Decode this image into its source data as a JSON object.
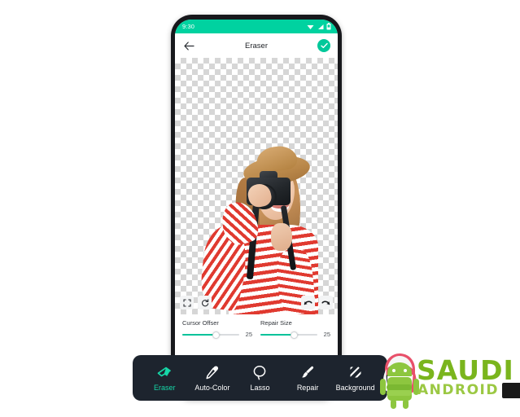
{
  "device": {
    "status_bar": {
      "time": "9:30",
      "icons": [
        "wifi-icon",
        "signal-icon",
        "battery-icon"
      ],
      "background_color": "#00d2a0"
    }
  },
  "app_bar": {
    "back_icon": "back-arrow-icon",
    "title": "Eraser",
    "confirm_icon": "check-icon",
    "confirm_color": "#00c89a"
  },
  "canvas": {
    "transparency_pattern": "checkerboard",
    "subject_description": "woman in red and white striped shirt and tan sun hat holding a black DSLR camera",
    "left_buttons": [
      {
        "name": "fit-to-screen-button",
        "icon": "fullscreen-icon"
      },
      {
        "name": "reset-button",
        "icon": "refresh-icon"
      }
    ],
    "right_buttons": [
      {
        "name": "undo-button",
        "icon": "undo-icon"
      },
      {
        "name": "redo-button",
        "icon": "redo-icon"
      }
    ]
  },
  "sliders": [
    {
      "label": "Cursor Offser",
      "value": "25",
      "percent": 58
    },
    {
      "label": "Repair Size",
      "value": "25",
      "percent": 58
    }
  ],
  "toolbar": {
    "background_color": "#1d242e",
    "active_color": "#16d6a7",
    "items": [
      {
        "label": "Eraser",
        "icon": "eraser-icon",
        "active": true
      },
      {
        "label": "Auto-Color",
        "icon": "eyedropper-icon",
        "active": false
      },
      {
        "label": "Lasso",
        "icon": "lasso-icon",
        "active": false
      },
      {
        "label": "Repair",
        "icon": "paintbrush-icon",
        "active": false
      },
      {
        "label": "Background",
        "icon": "diagonal-stripes-icon",
        "active": false
      }
    ]
  },
  "watermark": {
    "primary_text": "SAUDI",
    "secondary_text": "ANDROID",
    "primary_color": "#7ab51d",
    "secondary_color": "#9bc843",
    "mascot": "android-mascot-with-keffiyeh"
  }
}
